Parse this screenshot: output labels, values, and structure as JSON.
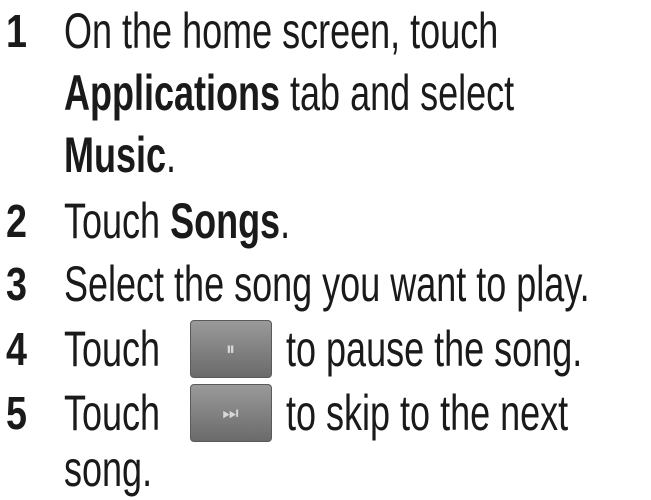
{
  "steps": [
    {
      "number": "1",
      "lines": [
        {
          "parts": [
            {
              "text": "On the home screen, touch",
              "bold": false
            }
          ]
        },
        {
          "parts": [
            {
              "text": "Applications",
              "bold": true
            },
            {
              "text": " tab and select",
              "bold": false
            }
          ]
        },
        {
          "parts": [
            {
              "text": "Music",
              "bold": true
            },
            {
              "text": ".",
              "bold": false
            }
          ]
        }
      ]
    },
    {
      "number": "2",
      "lines": [
        {
          "parts": [
            {
              "text": "Touch ",
              "bold": false
            },
            {
              "text": "Songs",
              "bold": true
            },
            {
              "text": ".",
              "bold": false
            }
          ]
        }
      ]
    },
    {
      "number": "3",
      "lines": [
        {
          "parts": [
            {
              "text": "Select the song you want to play.",
              "bold": false
            }
          ]
        }
      ]
    },
    {
      "number": "4",
      "before_icon": "Touch",
      "after_icon": "to pause the song.",
      "icon": "pause-icon",
      "icon_glyph": "⏸"
    },
    {
      "number": "5",
      "before_icon": "Touch",
      "after_icon": "to skip to the next",
      "continuation": "song.",
      "icon": "skip-next-icon",
      "icon_glyph": "⏭"
    }
  ],
  "colors": {
    "text": "#1a1a1a",
    "icon_bg": "#7f7f7f",
    "icon_glyph": "#d8d8d8"
  }
}
